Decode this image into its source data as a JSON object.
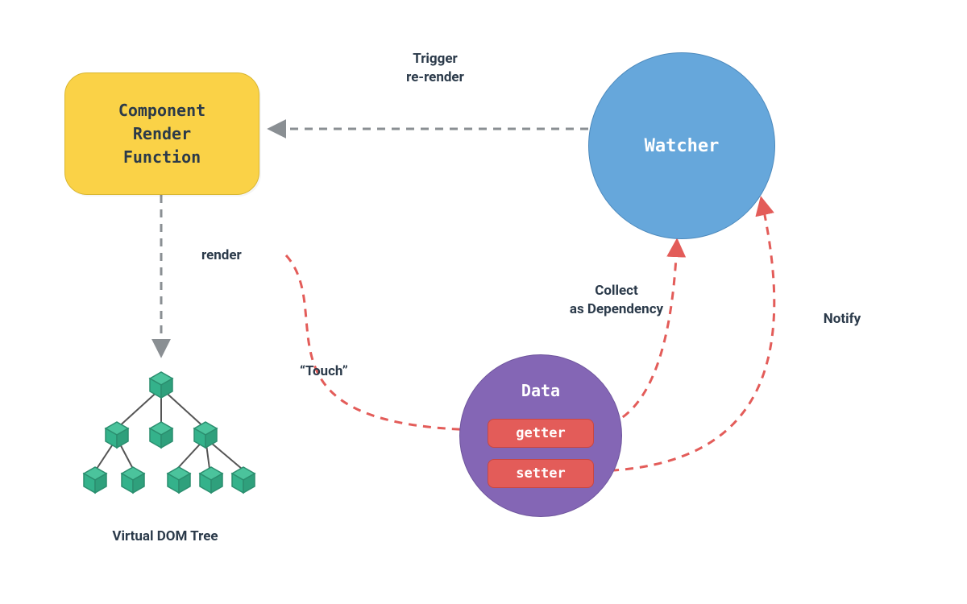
{
  "nodes": {
    "render_fn": "Component\nRender\nFunction",
    "watcher": "Watcher",
    "data": "Data",
    "getter": "getter",
    "setter": "setter",
    "vdom_tree": "Virtual DOM Tree"
  },
  "edges": {
    "trigger": "Trigger\nre-render",
    "render": "render",
    "touch": "“Touch”",
    "collect": "Collect\nas Dependency",
    "notify": "Notify"
  },
  "colors": {
    "render_box": "#FAD247",
    "watcher_circle": "#66A7DB",
    "data_circle": "#8466B5",
    "pill": "#E35C59",
    "text_dark": "#2B3A4A",
    "text_light": "#FFFFFF",
    "arrow_gray": "#8A8F93",
    "arrow_red": "#E35C59",
    "tree_green": "#34B28B",
    "tree_green_dark": "#2B8E6F"
  }
}
